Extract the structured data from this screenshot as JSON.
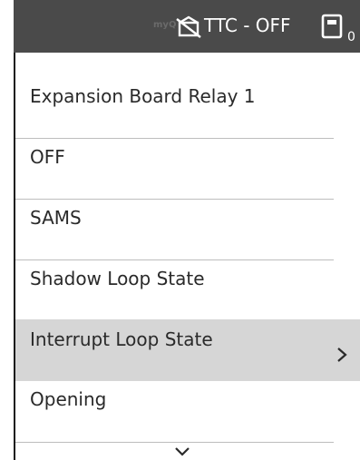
{
  "header": {
    "brand": "myQ",
    "status": "TTC - OFF",
    "count": "0",
    "icons": [
      "door-closed-off-icon",
      "device-panel-icon"
    ]
  },
  "menu": {
    "items": [
      {
        "label": "Expansion Board Relay 1"
      },
      {
        "label": "OFF"
      },
      {
        "label": "SAMS"
      },
      {
        "label": "Shadow Loop State"
      },
      {
        "label": "Interrupt Loop State"
      },
      {
        "label": "Opening"
      }
    ],
    "selected_index": 4
  },
  "colors": {
    "header_bg": "#4a4a4a",
    "selected_bg": "#d6d6d6",
    "text": "#2a2a2a"
  }
}
